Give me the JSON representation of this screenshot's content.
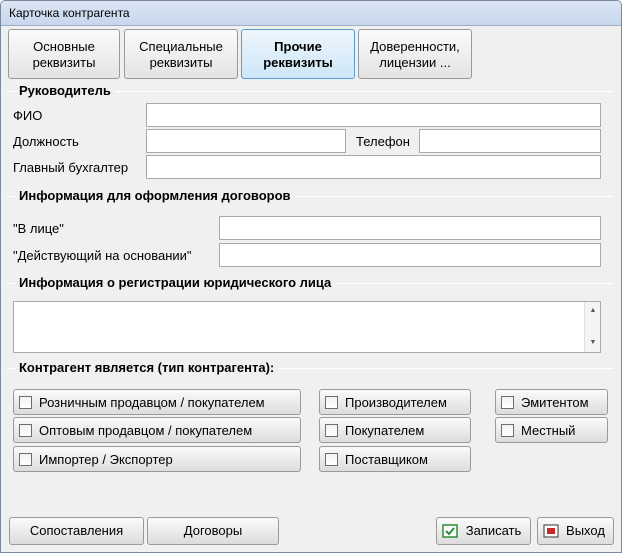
{
  "window": {
    "title": "Карточка контрагента"
  },
  "tabs": [
    {
      "line1": "Основные",
      "line2": "реквизиты"
    },
    {
      "line1": "Специальные",
      "line2": "реквизиты"
    },
    {
      "line1": "Прочие",
      "line2": "реквизиты"
    },
    {
      "line1": "Доверенности,",
      "line2": "лицензии ..."
    }
  ],
  "manager": {
    "title": "Руководитель",
    "fio_label": "ФИО",
    "fio_value": "",
    "position_label": "Должность",
    "position_value": "",
    "phone_label": "Телефон",
    "phone_value": "",
    "accountant_label": "Главный бухгалтер",
    "accountant_value": ""
  },
  "contracts": {
    "title": "Информация для оформления договоров",
    "in_person_label": "\"В лице\"",
    "in_person_value": "",
    "acting_label": "\"Действующий на основании\"",
    "acting_value": ""
  },
  "registration": {
    "title": "Информация о регистрации юридического лица",
    "value": ""
  },
  "contractor_type": {
    "title": "Контрагент является (тип контрагента):",
    "options": [
      {
        "label": "Розничным продавцом / покупателем",
        "checked": false
      },
      {
        "label": "Оптовым продавцом / покупателем",
        "checked": false
      },
      {
        "label": "Импортер / Экспортер",
        "checked": false
      },
      {
        "label": "Производителем",
        "checked": false
      },
      {
        "label": "Покупателем",
        "checked": false
      },
      {
        "label": "Поставщиком",
        "checked": false
      },
      {
        "label": "Эмитентом",
        "checked": false
      },
      {
        "label": "Местный",
        "checked": false
      }
    ]
  },
  "buttons": {
    "mapping": "Сопоставления",
    "contracts": "Договоры",
    "save": "Записать",
    "exit": "Выход"
  },
  "colors": {
    "active_tab_border": "#5a9bd4",
    "save_icon": "#2e8b3a",
    "exit_icon": "#c62828"
  }
}
